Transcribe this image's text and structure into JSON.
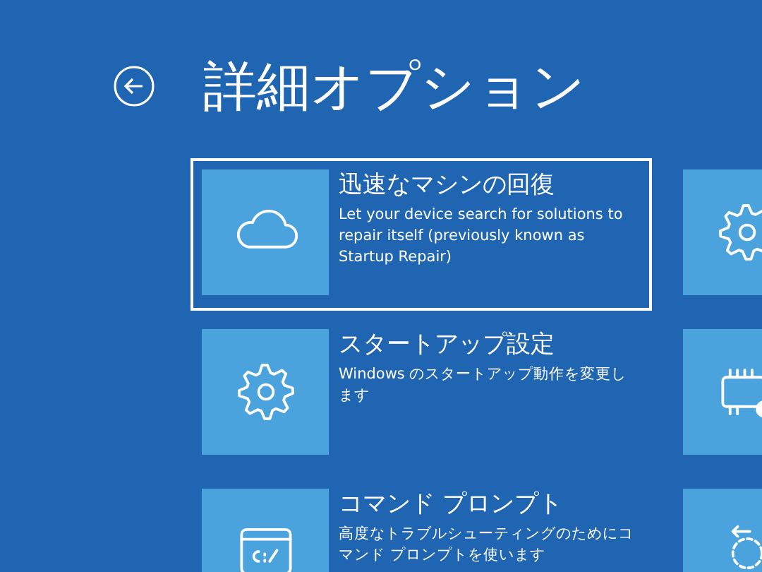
{
  "header": {
    "title": "詳細オプション"
  },
  "options": [
    {
      "kind": "cloud",
      "title": "迅速なマシンの回復",
      "description": "Let your device search for solutions to repair itself (previously known as Startup Repair)",
      "selected": true
    },
    {
      "kind": "gear",
      "title": "スタートアップ設定",
      "description": "Windows のスタートアップ動作を変更します",
      "selected": false
    },
    {
      "kind": "command",
      "title": "コマンド プロンプト",
      "description": "高度なトラブルシューティングのためにコマンド プロンプトを使います",
      "selected": false
    },
    {
      "kind": "gear",
      "selected": false
    },
    {
      "kind": "firmware",
      "selected": false
    },
    {
      "kind": "restore",
      "selected": false
    }
  ]
}
